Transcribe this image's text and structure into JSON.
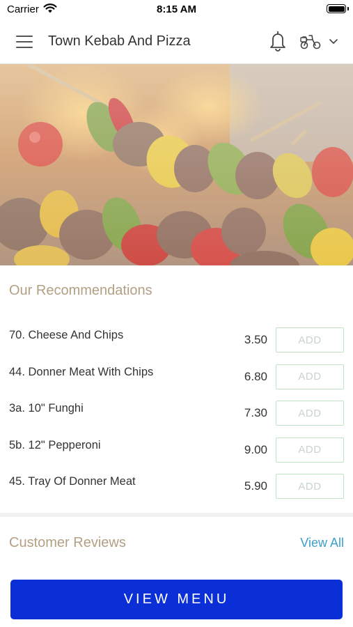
{
  "status_bar": {
    "carrier": "Carrier",
    "time": "8:15 AM",
    "icons": [
      "wifi-icon",
      "battery-icon"
    ]
  },
  "header": {
    "title": "Town Kebab And Pizza",
    "icons": [
      "menu-icon",
      "bell-icon",
      "scooter-icon",
      "chevron-down-icon"
    ]
  },
  "hero": {
    "image": "kebab-skewers-over-flames"
  },
  "recommendations": {
    "title": "Our Recommendations",
    "add_label": "ADD",
    "items": [
      {
        "name": "70. Cheese And Chips",
        "price": "3.50"
      },
      {
        "name": "44. Donner Meat With Chips",
        "price": "6.80"
      },
      {
        "name": "3a. 10\" Funghi",
        "price": "7.30"
      },
      {
        "name": "5b. 12\" Pepperoni",
        "price": "9.00"
      },
      {
        "name": "45. Tray Of Donner Meat",
        "price": "5.90"
      }
    ]
  },
  "reviews": {
    "title": "Customer Reviews",
    "view_all": "View All"
  },
  "footer": {
    "view_menu": "VIEW MENU"
  },
  "colors": {
    "accent_blue": "#0a2fd6",
    "section_title": "#b3a084",
    "link": "#3a9fc9",
    "add_border": "#bfe2c8"
  }
}
